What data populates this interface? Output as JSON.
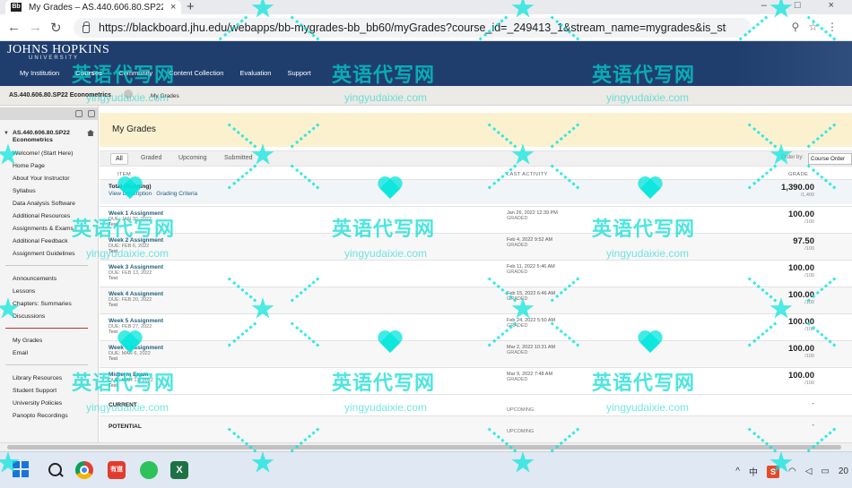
{
  "browser": {
    "tab_title": "My Grades – AS.440.606.80.SP22",
    "favicon_text": "Bb",
    "tab_close": "×",
    "new_tab": "+",
    "window_controls": "– □ ×",
    "url": "https://blackboard.jhu.edu/webapps/bb-mygrades-bb_bb60/myGrades?course_id=_249413_1&stream_name=mygrades&is_str..."
  },
  "banner": {
    "logo": "JOHNS HOPKINS",
    "logo_sub": "UNIVERSITY",
    "nav": [
      "My Institution",
      "Courses",
      "Community",
      "Content Collection",
      "Evaluation",
      "Support"
    ],
    "active_nav": "Courses"
  },
  "breadcrumb": {
    "course": "AS.440.606.80.SP22 Econometrics",
    "current": "My Grades"
  },
  "sidebar": {
    "course_title": "AS.440.606.80.SP22 Econometrics",
    "group1": [
      "Welcome! (Start Here)",
      "Home Page",
      "About Your Instructor",
      "Syllabus",
      "Data Analysis Software",
      "Additional Resources",
      "Assignments & Exams",
      "Additional Feedback",
      "Assignment Guidelines"
    ],
    "group2": [
      "Announcements",
      "Lessons",
      "Chapters: Summaries",
      "Discussions"
    ],
    "group3": [
      "My Grades",
      "Email"
    ],
    "group4": [
      "Library Resources",
      "Student Support",
      "University Policies",
      "Panopto Recordings"
    ]
  },
  "main": {
    "title": "My Grades",
    "filters": [
      "All",
      "Graded",
      "Upcoming",
      "Submitted"
    ],
    "order_label": "Order by:",
    "order_value": "Course Order",
    "col_item": "ITEM",
    "col_activity": "LAST ACTIVITY",
    "col_grade": "GRADE",
    "total": {
      "title": "Total (Running)",
      "link1": "View Description",
      "link2": "Grading Criteria",
      "grade": "1,390.00",
      "out_of": "/1,400"
    },
    "rows": [
      {
        "title": "Week 1 Assignment",
        "due": "DUE: JAN 30, 2022",
        "category": "Test",
        "date": "Jan 26, 2022 12:39 PM",
        "status": "GRADED",
        "grade": "100.00",
        "out_of": "/100"
      },
      {
        "title": "Week 2 Assignment",
        "due": "DUE: FEB 6, 2022",
        "category": "Test",
        "date": "Feb 4, 2022 9:52 AM",
        "status": "GRADED",
        "grade": "97.50",
        "out_of": "/100"
      },
      {
        "title": "Week 3 Assignment",
        "due": "DUE: FEB 13, 2022",
        "category": "Test",
        "date": "Feb 11, 2022 5:46 AM",
        "status": "GRADED",
        "grade": "100.00",
        "out_of": "/100"
      },
      {
        "title": "Week 4 Assignment",
        "due": "DUE: FEB 20, 2022",
        "category": "Test",
        "date": "Feb 15, 2022 6:46 AM",
        "status": "GRADED",
        "grade": "100.00",
        "out_of": "/100"
      },
      {
        "title": "Week 5 Assignment",
        "due": "DUE: FEB 27, 2022",
        "category": "Test",
        "date": "Feb 24, 2022 5:50 AM",
        "status": "GRADED",
        "grade": "100.00",
        "out_of": "/100"
      },
      {
        "title": "Week 6 Assignment",
        "due": "DUE: MAR 6, 2022",
        "category": "Test",
        "date": "Mar 2, 2022 10:31 AM",
        "status": "GRADED",
        "grade": "100.00",
        "out_of": "/100"
      },
      {
        "title": "Midterm Exam",
        "due": "DUE: MAR 13, 2022",
        "category": "Test",
        "date": "Mar 9, 2022 7:48 AM",
        "status": "GRADED",
        "grade": "100.00",
        "out_of": "/100"
      }
    ],
    "current": {
      "title": "CURRENT",
      "status": "UPCOMING",
      "grade": "-"
    },
    "potential": {
      "title": "POTENTIAL",
      "status": "UPCOMING",
      "grade": "-"
    }
  },
  "taskbar": {
    "youdao": "有道",
    "excel": "X",
    "tray_arrow": "^",
    "tray_ime": "中",
    "tray_sogou": "S",
    "clock": "20"
  },
  "watermark": {
    "text": "英语代写网",
    "sub": "yingyudaixie.com"
  },
  "colors": {
    "banner": "#1f3e6e",
    "header_bg": "#fcf1cf",
    "link": "#20607e",
    "watermark": "#00dcd2"
  }
}
